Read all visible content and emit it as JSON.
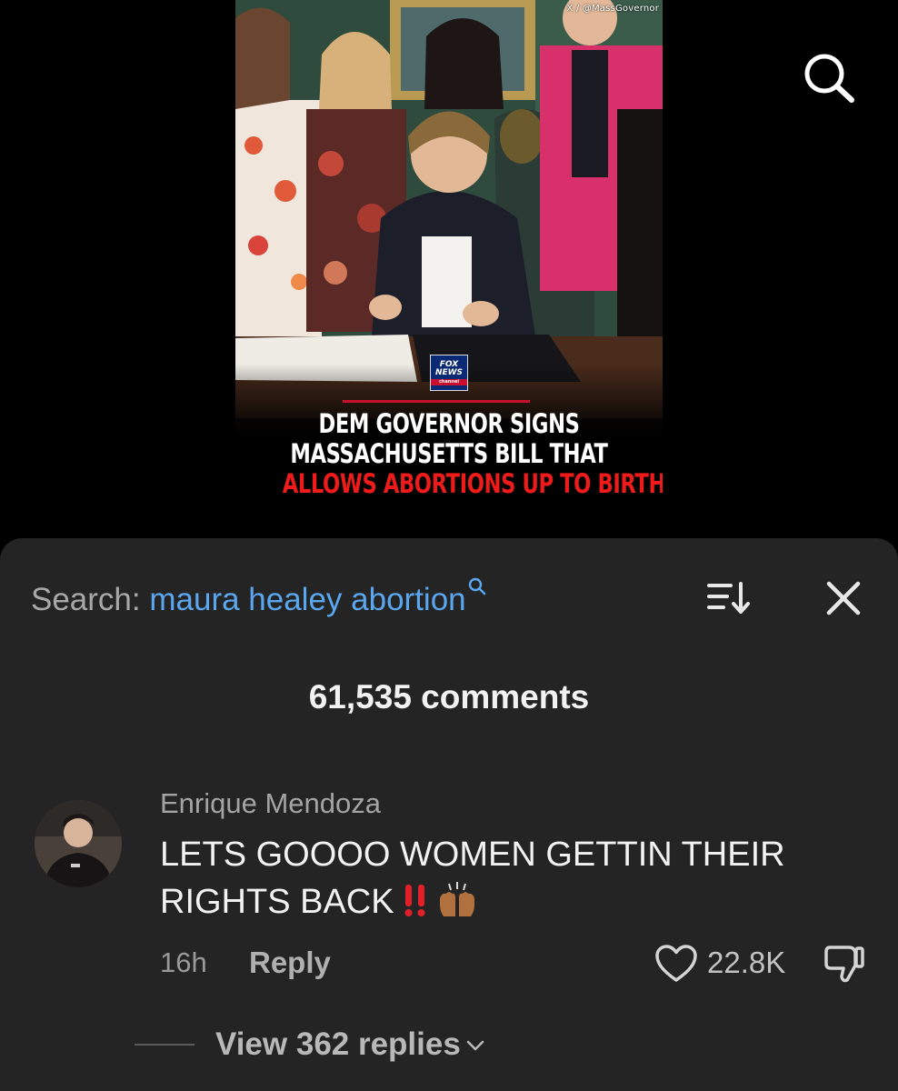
{
  "video": {
    "credit": "X / @MassGovernor",
    "logo": {
      "line1": "FOX",
      "line2": "NEWS",
      "line3": "channel"
    },
    "caption": {
      "line1": "DEM GOVERNOR SIGNS",
      "line2": "MASSACHUSETTS BILL THAT",
      "line3": "ALLOWS ABORTIONS UP TO BIRTH"
    }
  },
  "sheet": {
    "search_label": "Search:",
    "search_query": "maura healey abortion",
    "comment_count": "61,535 comments"
  },
  "comment": {
    "author": "Enrique Mendoza",
    "text": "LETS GOOOO WOMEN GETTIN THEIR RIGHTS BACK",
    "emojis": [
      "double-exclamation",
      "raising-hands"
    ],
    "time": "16h",
    "reply_label": "Reply",
    "likes": "22.8K",
    "view_replies": "View 362 replies"
  },
  "colors": {
    "sheet_bg": "#242424",
    "query_blue": "#5aa7f0",
    "caption_red": "#ef1b1b",
    "fox_blue": "#0c2a73"
  }
}
